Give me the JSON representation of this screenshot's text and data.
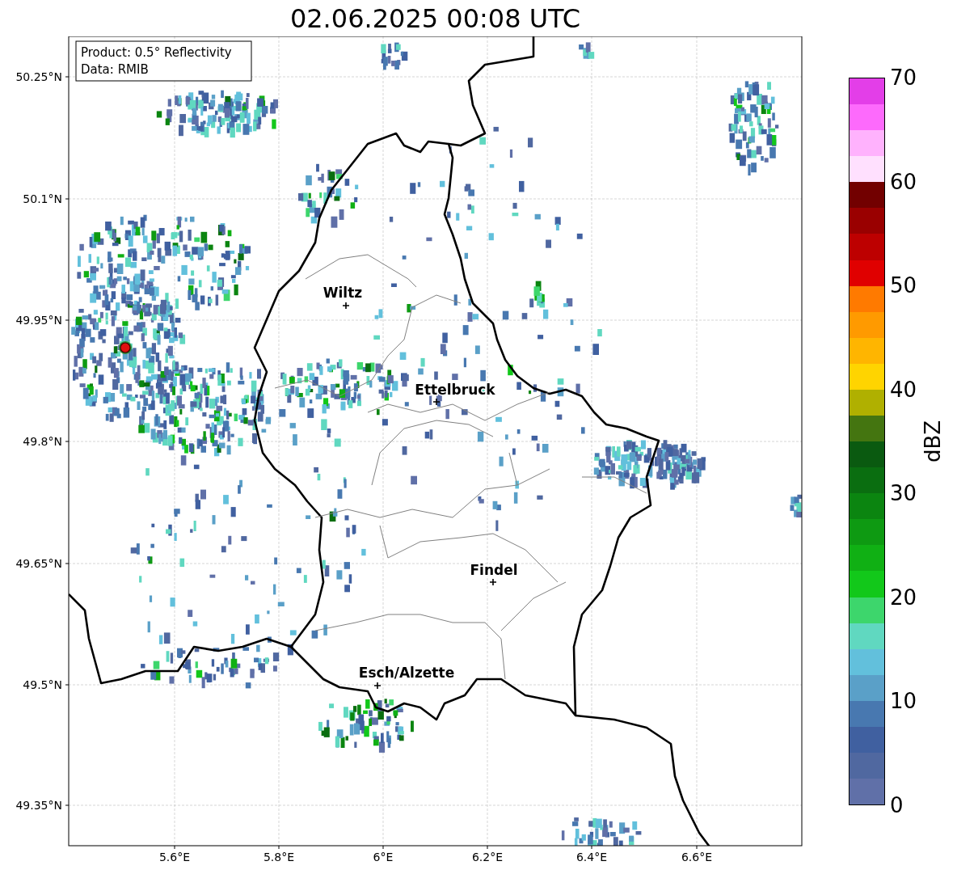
{
  "title": "02.06.2025 00:08 UTC",
  "info_box": [
    "Product: 0.5° Reflectivity",
    "Data: RMIB"
  ],
  "map": {
    "lat_ticks": [
      "50.25°N",
      "50.1°N",
      "49.95°N",
      "49.8°N",
      "49.65°N",
      "49.5°N",
      "49.35°N"
    ],
    "lon_ticks": [
      "5.6°E",
      "5.8°E",
      "6°E",
      "6.2°E",
      "6.4°E",
      "6.6°E"
    ],
    "cities": [
      {
        "name": "Wiltz"
      },
      {
        "name": "Ettelbruck"
      },
      {
        "name": "Findel"
      },
      {
        "name": "Esch/Alzette"
      }
    ]
  },
  "colorbar": {
    "label": "dBZ",
    "ticks": [
      "70",
      "60",
      "50",
      "40",
      "30",
      "20",
      "10",
      "0"
    ],
    "segments": [
      {
        "color": "#e33ee8"
      },
      {
        "color": "#fd6afc"
      },
      {
        "color": "#ffb2fd"
      },
      {
        "color": "#ffe0fe"
      },
      {
        "color": "#720000"
      },
      {
        "color": "#9a0000"
      },
      {
        "color": "#bd0000"
      },
      {
        "color": "#e00000"
      },
      {
        "color": "#ff7a00"
      },
      {
        "color": "#ff9a00"
      },
      {
        "color": "#ffb500"
      },
      {
        "color": "#ffd400"
      },
      {
        "color": "#b0b000"
      },
      {
        "color": "#447510"
      },
      {
        "color": "#0a5a10"
      },
      {
        "color": "#0a6e10"
      },
      {
        "color": "#0b8510"
      },
      {
        "color": "#0e9a12"
      },
      {
        "color": "#10b014"
      },
      {
        "color": "#12c81a"
      },
      {
        "color": "#3dd66c"
      },
      {
        "color": "#60d8c0"
      },
      {
        "color": "#62c0dc"
      },
      {
        "color": "#5aa0c8"
      },
      {
        "color": "#4878b0"
      },
      {
        "color": "#4060a0"
      },
      {
        "color": "#5068a0"
      },
      {
        "color": "#6070a8"
      }
    ]
  }
}
